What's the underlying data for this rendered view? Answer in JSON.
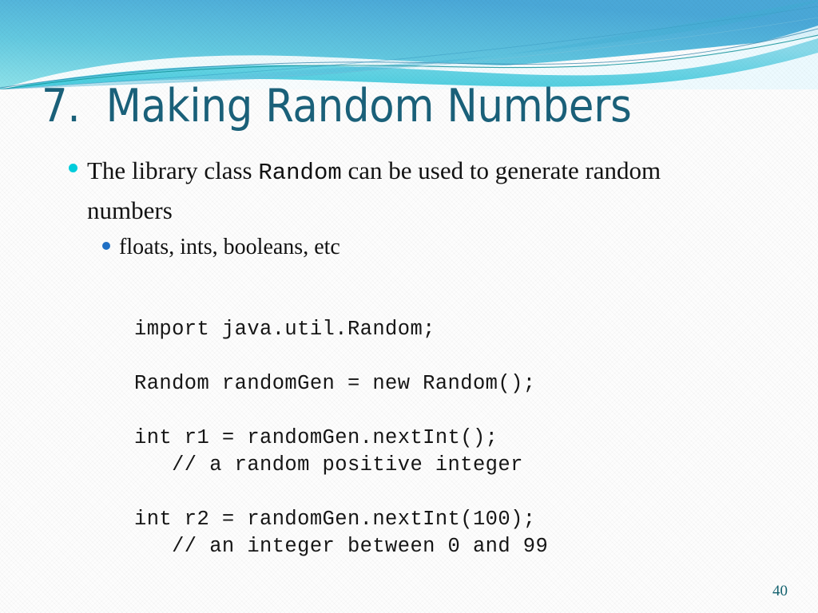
{
  "slide": {
    "title": "7.  Making Random Numbers",
    "page_number": "40",
    "colors": {
      "title": "#1a6079",
      "bullet_level1_dot": "#00ccdb",
      "bullet_level2_dot": "#1f6fc4",
      "body_text": "#121212",
      "page_number": "#14626f",
      "banner_cyan": "#6fd9e3",
      "banner_blue": "#5fb6dd",
      "banner_teal": "#14868f"
    }
  },
  "banner": {
    "name": "decorative-wave-banner"
  },
  "bullets": [
    {
      "level": 1,
      "segments": [
        {
          "text": "The library class ",
          "style": "serif"
        },
        {
          "text": "Random",
          "style": "mono"
        },
        {
          "text": " can be used to generate random numbers",
          "style": "serif"
        }
      ]
    },
    {
      "level": 2,
      "text": "floats, ints, booleans, etc"
    }
  ],
  "code": {
    "language": "java",
    "lines": [
      "import java.util.Random;",
      "",
      "Random randomGen = new Random();",
      "",
      "int r1 = randomGen.nextInt();",
      "   // a random positive integer",
      "",
      "int r2 = randomGen.nextInt(100);",
      "   // an integer between 0 and 99"
    ]
  }
}
